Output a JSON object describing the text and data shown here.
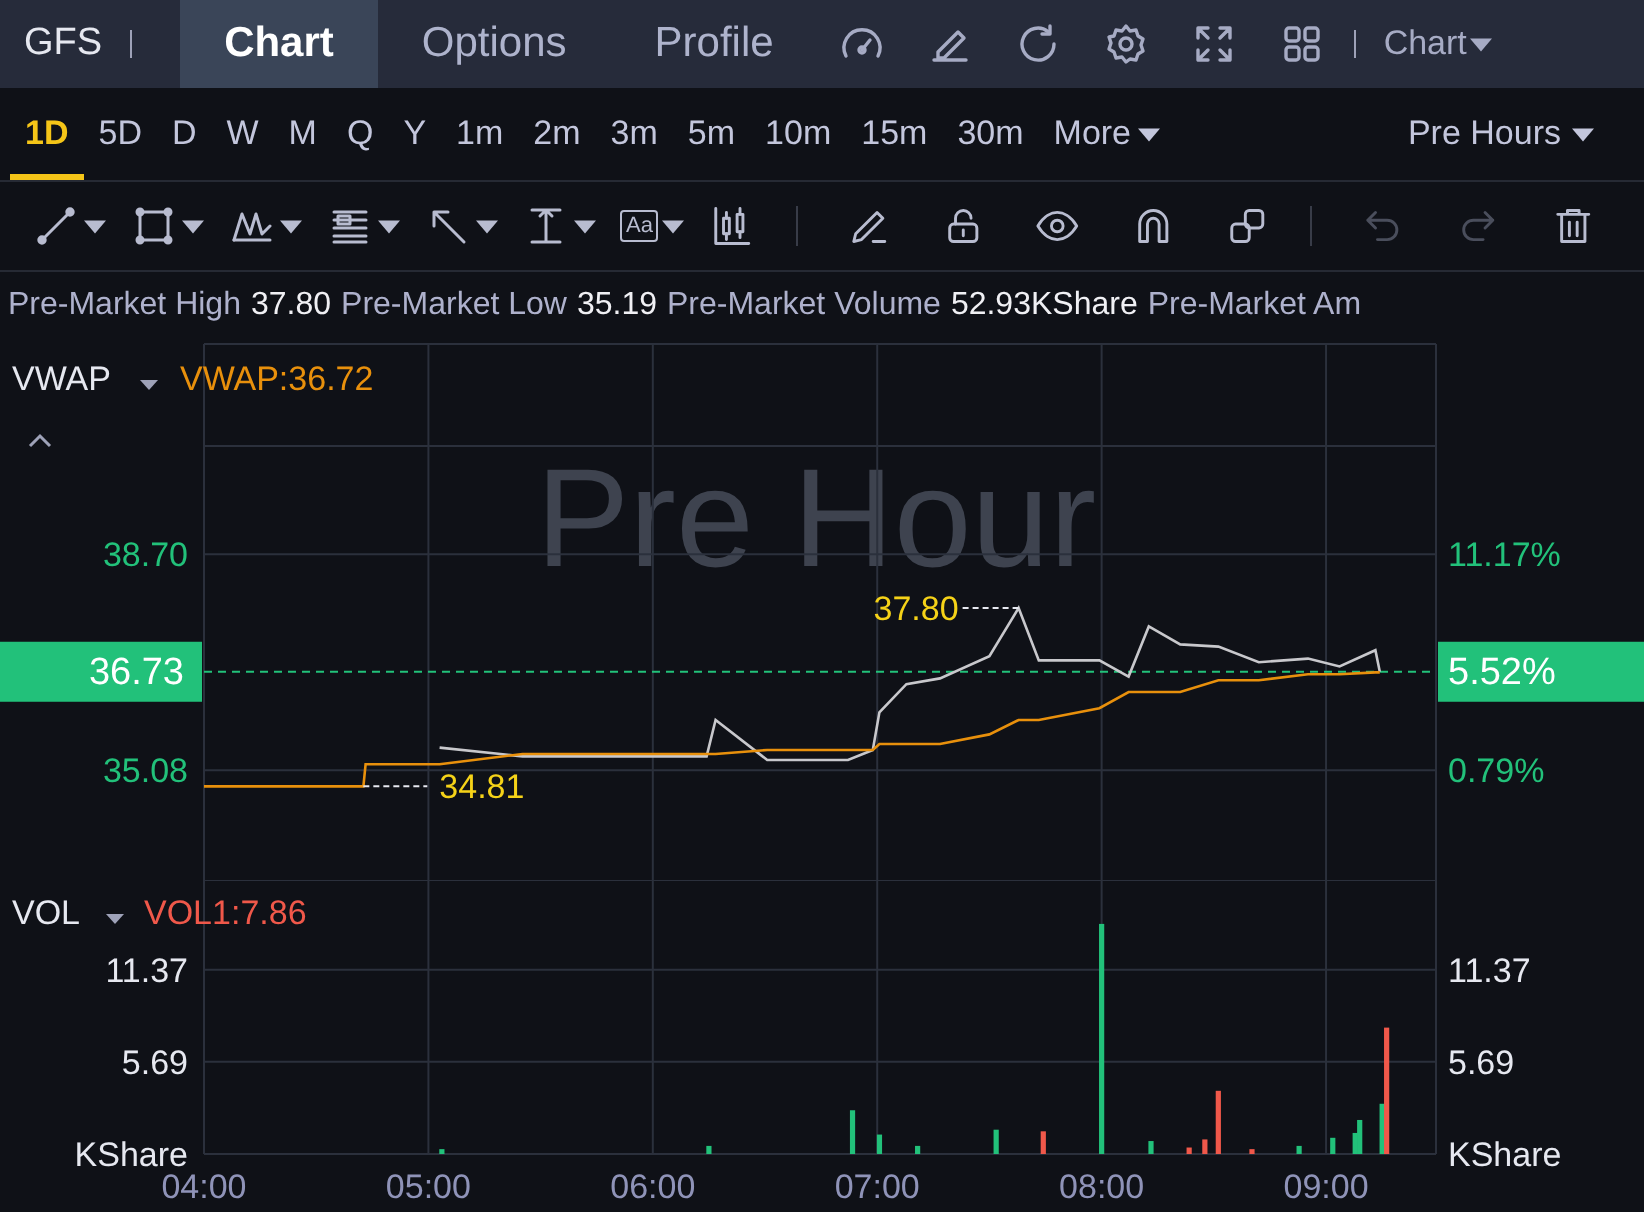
{
  "header": {
    "symbol": "GFS",
    "tabs": [
      {
        "label": "Chart",
        "selected": true
      },
      {
        "label": "Options",
        "selected": false
      },
      {
        "label": "Profile",
        "selected": false
      }
    ],
    "chart_menu": "Chart"
  },
  "timeframes": [
    {
      "label": "1D",
      "selected": true
    },
    {
      "label": "5D",
      "selected": false
    },
    {
      "label": "D",
      "selected": false
    },
    {
      "label": "W",
      "selected": false
    },
    {
      "label": "M",
      "selected": false
    },
    {
      "label": "Q",
      "selected": false
    },
    {
      "label": "Y",
      "selected": false
    },
    {
      "label": "1m",
      "selected": false
    },
    {
      "label": "2m",
      "selected": false
    },
    {
      "label": "3m",
      "selected": false
    },
    {
      "label": "5m",
      "selected": false
    },
    {
      "label": "10m",
      "selected": false
    },
    {
      "label": "15m",
      "selected": false
    },
    {
      "label": "30m",
      "selected": false
    }
  ],
  "more_menu": "More",
  "session_menu": "Pre Hours",
  "toolbar": {
    "text_tool_label": "Aa",
    "undo": {
      "disabled": true
    },
    "redo": {
      "disabled": true
    }
  },
  "stats": [
    {
      "label": "Pre-Market High",
      "value": "37.80"
    },
    {
      "label": "Pre-Market Low",
      "value": "35.19"
    },
    {
      "label": "Pre-Market Volume",
      "value": "52.93KShare"
    },
    {
      "label": "Pre-Market Am"
    }
  ],
  "price_pane": {
    "indicator": "VWAP",
    "legend": "VWAP:36.72",
    "watermark": "Pre Hour",
    "right_axis_labels": [
      "11.17%",
      "0.79%"
    ],
    "last_change": "5.52%",
    "chart_data": {
      "type": "line",
      "x": [
        4.0,
        4.71,
        4.72,
        5.05,
        5.42,
        6.24,
        6.28,
        6.51,
        6.87,
        6.98,
        7.01,
        7.13,
        7.28,
        7.5,
        7.63,
        7.72,
        7.99,
        8.12,
        8.21,
        8.35,
        8.52,
        8.7,
        8.92,
        9.06,
        9.22,
        9.24
      ],
      "series": [
        {
          "color": "#c8c8cc",
          "values": [
            null,
            null,
            null,
            35.46,
            35.31,
            35.31,
            35.92,
            35.25,
            35.25,
            35.42,
            36.05,
            36.52,
            36.62,
            36.99,
            37.8,
            36.92,
            36.92,
            36.65,
            37.49,
            37.19,
            37.15,
            36.89,
            36.95,
            36.82,
            37.09,
            36.73
          ]
        },
        {
          "color": "#e8900c",
          "values": [
            34.81,
            34.81,
            35.18,
            35.18,
            35.35,
            35.35,
            35.35,
            35.42,
            35.42,
            35.42,
            35.52,
            35.52,
            35.52,
            35.68,
            35.92,
            35.92,
            36.12,
            36.39,
            36.39,
            36.39,
            36.59,
            36.59,
            36.69,
            36.69,
            36.72,
            36.72
          ]
        }
      ],
      "xlim": [
        4,
        9.49
      ],
      "ylim": [
        33.24,
        42.29
      ],
      "yticks": [
        {
          "value": 38.7,
          "label": "38.70"
        },
        {
          "value": 35.08,
          "label": "35.08"
        }
      ],
      "grid": true,
      "ref_lines": [
        {
          "axis": "y",
          "value": 36.73,
          "label": "36.73",
          "color": "#22c17a"
        }
      ],
      "annotations": [
        {
          "text": "37.80",
          "x": 7.63,
          "y": 37.8
        },
        {
          "text": "34.81",
          "x": 4.71,
          "y": 34.81
        }
      ]
    }
  },
  "volume_pane": {
    "indicator": "VOL",
    "legend": "VOL1:7.86",
    "unit_left": "KShare",
    "unit_right": "KShare",
    "chart_data": {
      "type": "bar",
      "x": [
        5.06,
        6.25,
        6.89,
        7.01,
        7.18,
        7.53,
        7.74,
        8.0,
        8.22,
        8.39,
        8.46,
        8.52,
        8.67,
        8.88,
        9.03,
        9.13,
        9.15,
        9.25,
        9.27
      ],
      "series": [
        {
          "color": "#22c17a",
          "values": [
            0.3,
            0.5,
            2.7,
            1.2,
            0.5,
            1.5,
            null,
            14.2,
            0.8,
            null,
            null,
            null,
            null,
            0.5,
            1.0,
            1.3,
            2.1,
            3.1,
            null
          ]
        },
        {
          "color": "#f0584a",
          "values": [
            null,
            null,
            null,
            null,
            null,
            null,
            1.4,
            null,
            null,
            0.4,
            0.9,
            3.9,
            0.3,
            null,
            null,
            null,
            null,
            null,
            7.8
          ]
        }
      ],
      "xlim": [
        4,
        9.49
      ],
      "ylim": [
        0,
        16.91
      ],
      "yticks": [
        {
          "value": 11.37,
          "label": "11.37"
        },
        {
          "value": 5.69,
          "label": "5.69"
        }
      ],
      "grid": true,
      "xticks": [
        {
          "value": 4,
          "label": "04:00"
        },
        {
          "value": 5,
          "label": "05:00"
        },
        {
          "value": 6,
          "label": "06:00"
        },
        {
          "value": 7,
          "label": "07:00"
        },
        {
          "value": 8,
          "label": "08:00"
        },
        {
          "value": 9,
          "label": "09:00"
        }
      ]
    }
  }
}
